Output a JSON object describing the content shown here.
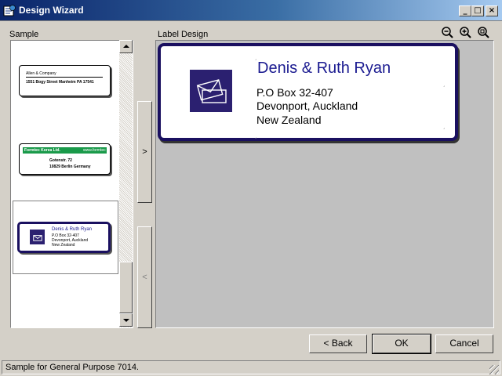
{
  "window": {
    "title": "Design Wizard",
    "minimize": "_",
    "maximize": "□",
    "close": "×"
  },
  "panels": {
    "sample_label": "Sample",
    "design_label": "Label Design"
  },
  "samples": [
    {
      "lines": [
        "Allen & Company",
        "1551 Bogy Street Manheim PA 17541"
      ]
    },
    {
      "header": "Formtec Korea Ltd.",
      "tag": "www.formtec",
      "lines": [
        "Gotenstr. 72",
        "10829 Berlin Germany"
      ]
    },
    {
      "lines": [
        "Denis & Ruth Ryan",
        "P.O Box 32-407",
        "Devonport, Auckland",
        "New Zealand"
      ],
      "selected": true
    }
  ],
  "move_buttons": {
    "right": ">",
    "left": "<"
  },
  "label_design": {
    "name": "Denis & Ruth Ryan",
    "line1": "P.O Box 32-407",
    "line2": "Devonport, Auckland",
    "line3": "New Zealand",
    "accent_color": "#1a1060",
    "name_color": "#1a1a90"
  },
  "buttons": {
    "back": "< Back",
    "ok": "OK",
    "cancel": "Cancel"
  },
  "status_text": "Sample for General Purpose 7014."
}
